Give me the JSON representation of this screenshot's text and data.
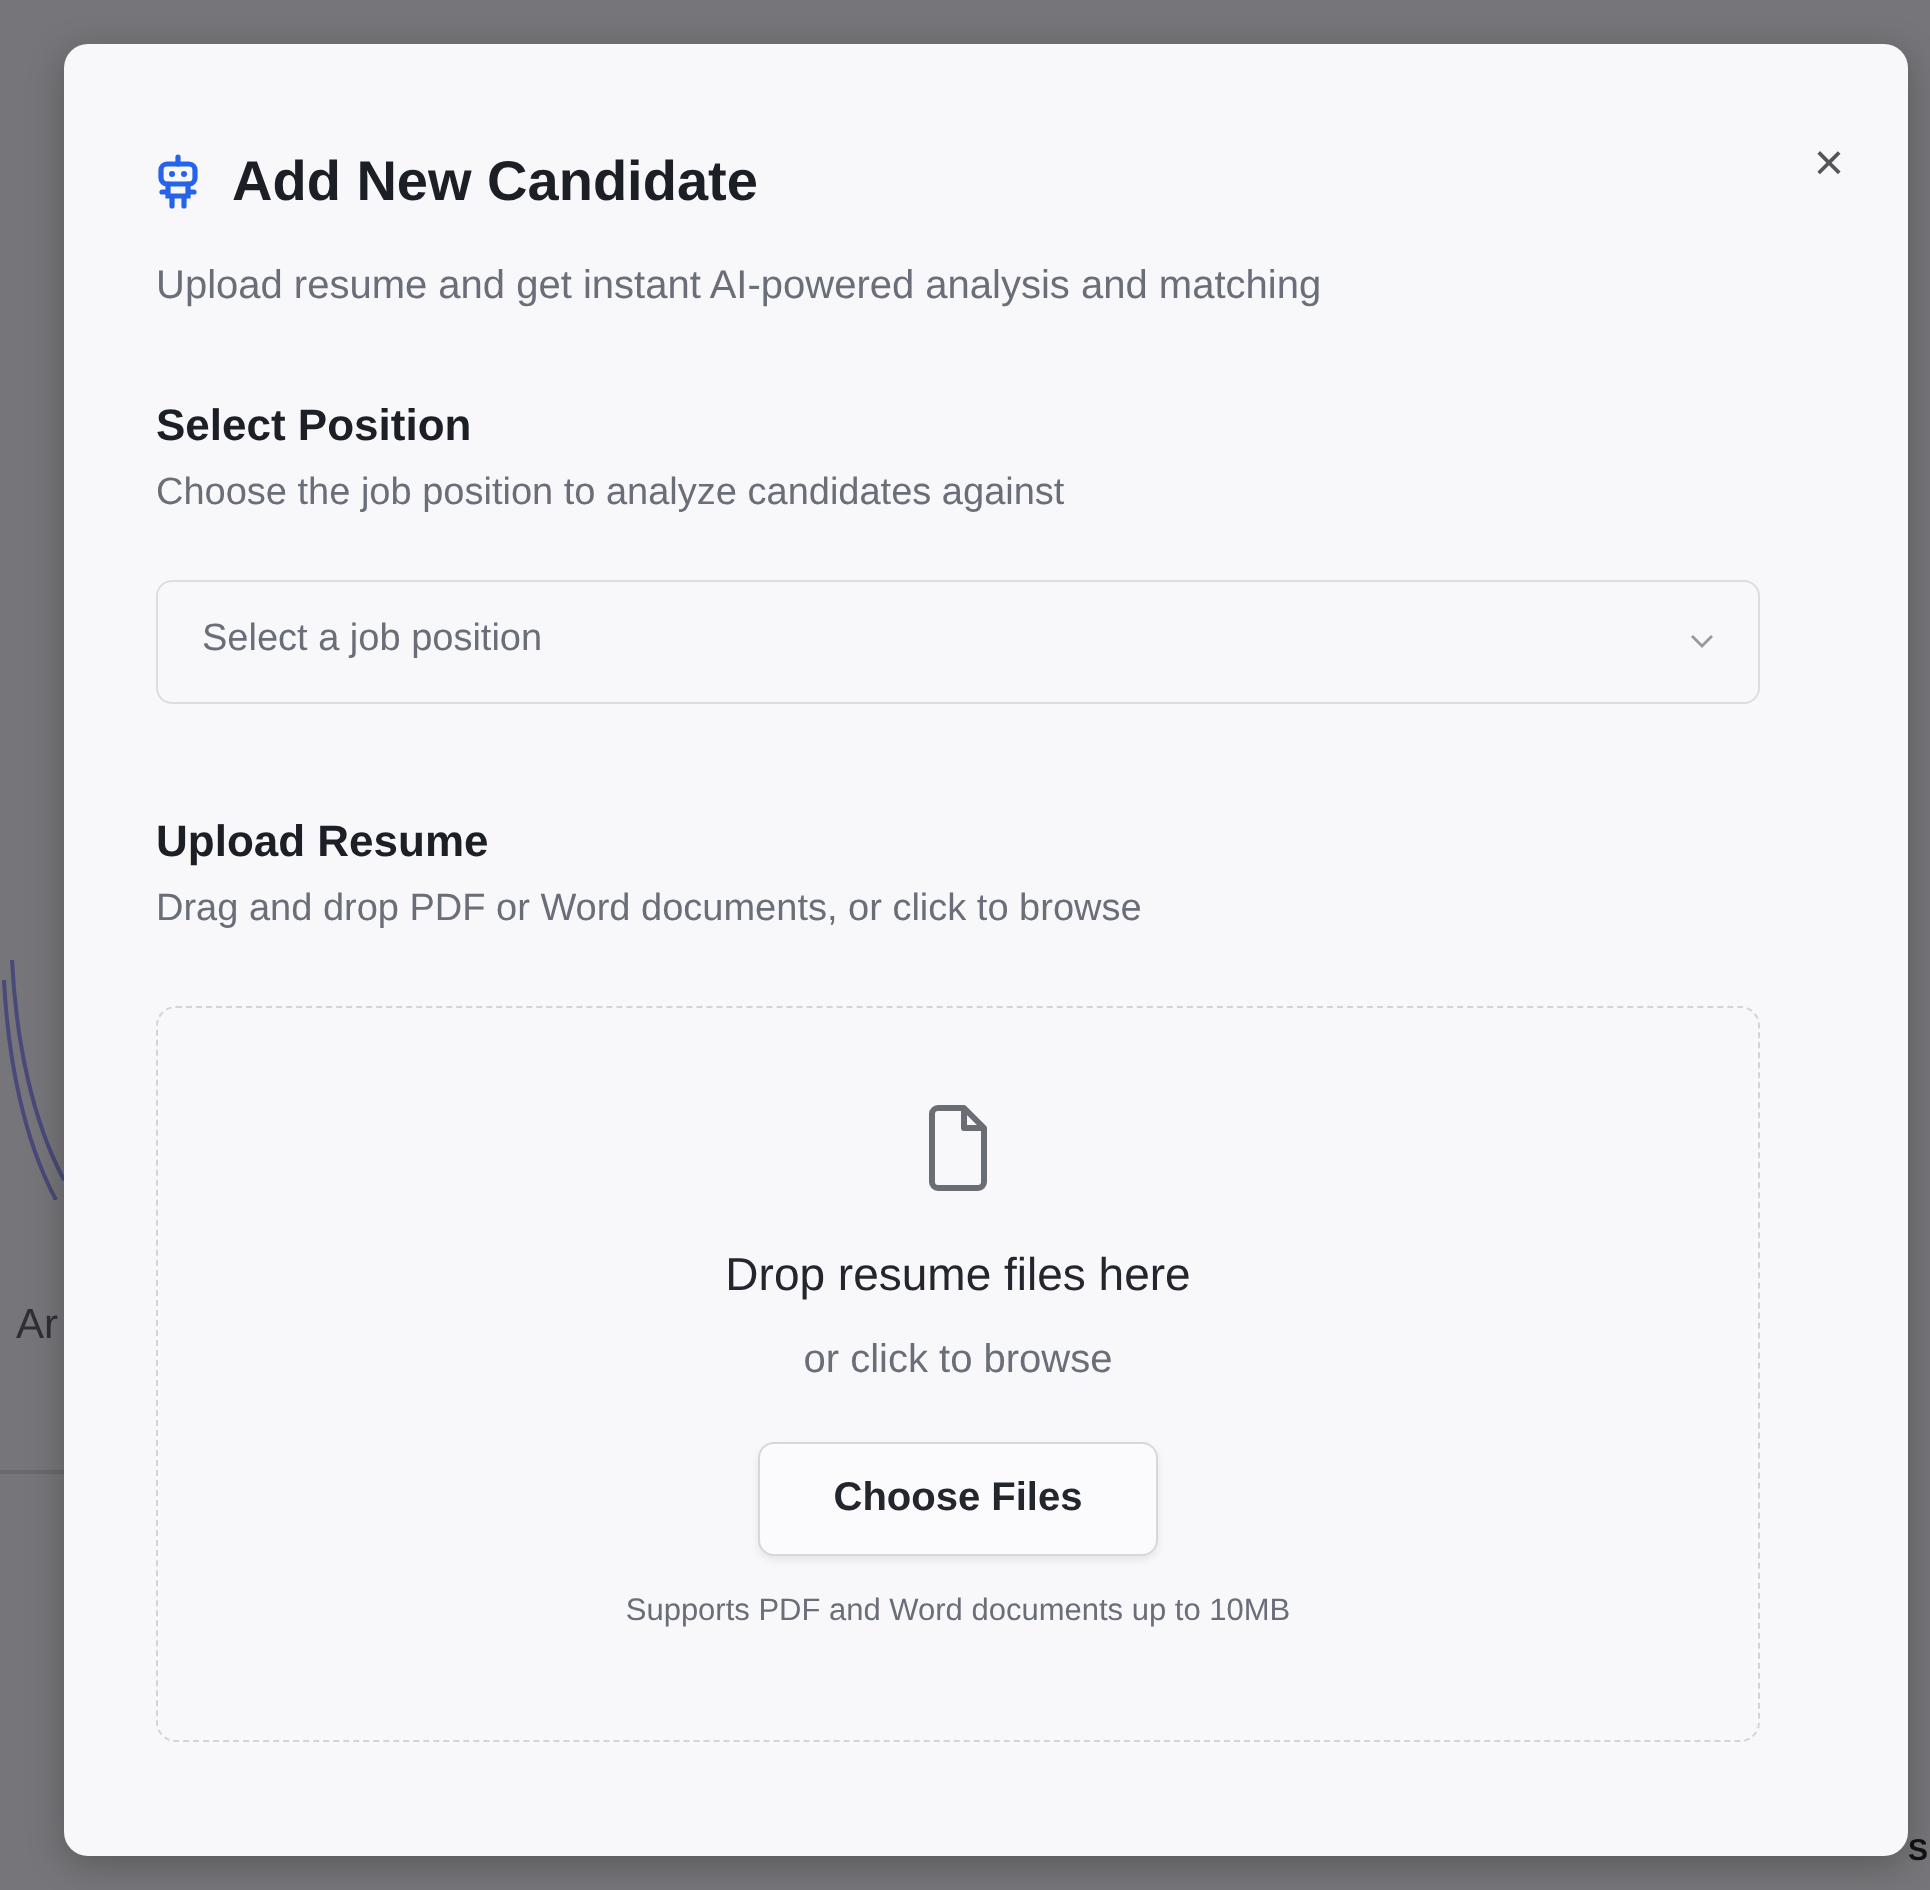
{
  "background_texts": [
    {
      "text": "Ar",
      "kind": "left"
    },
    {
      "text": "S",
      "kind": "right"
    }
  ],
  "dialog": {
    "title": "Add New Candidate",
    "subtitle": "Upload resume and get instant AI-powered analysis and matching",
    "close": "×"
  },
  "position": {
    "heading": "Select Position",
    "description": "Choose the job position to analyze candidates against",
    "placeholder": "Select a job position"
  },
  "upload": {
    "heading": "Upload Resume",
    "description": "Drag and drop PDF or Word documents, or click to browse",
    "drop_title": "Drop resume files here",
    "drop_hint": "or click to browse",
    "button": "Choose Files",
    "note": "Supports PDF and Word documents up to 10MB"
  }
}
